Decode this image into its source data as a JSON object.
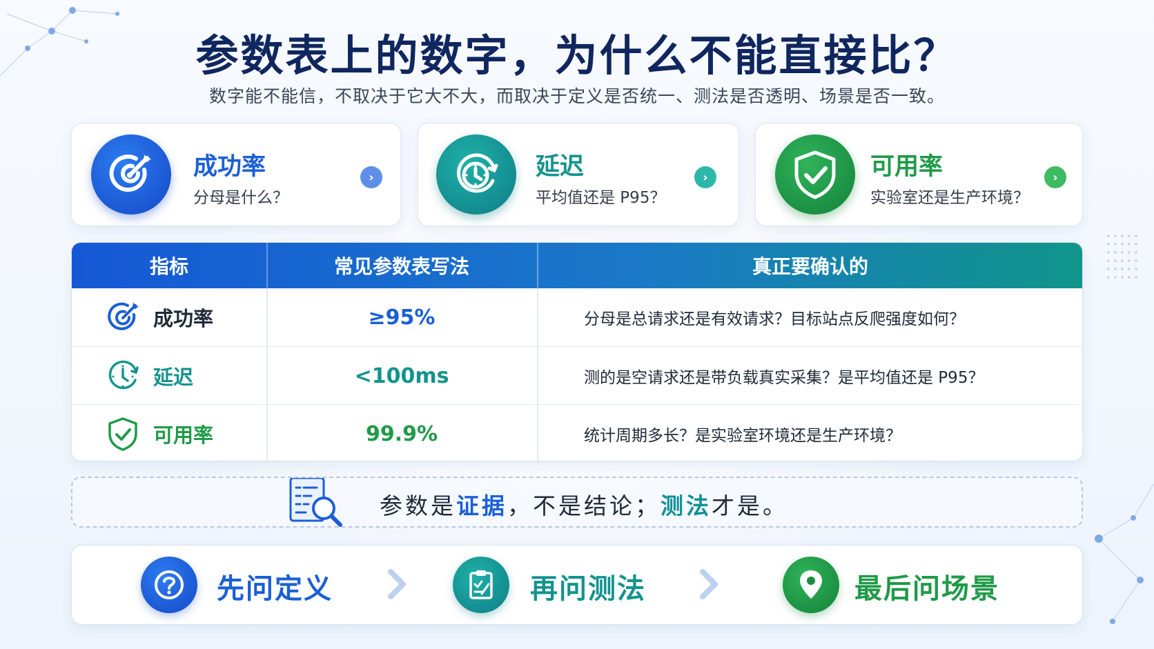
{
  "title": "参数表上的数字，为什么不能直接比？",
  "subtitle": "数字能不能信，不取决于它大不大，而取决于定义是否统一、测法是否透明、场景是否一致。",
  "cards": [
    {
      "title": "成功率",
      "sub": "分母是什么？",
      "icon": "target-icon",
      "color": "#1a5fd6"
    },
    {
      "title": "延迟",
      "sub": "平均值还是 P95？",
      "icon": "clock-icon",
      "color": "#13938f"
    },
    {
      "title": "可用率",
      "sub": "实验室还是生产环境？",
      "icon": "shield-check-icon",
      "color": "#1f9a48"
    }
  ],
  "table": {
    "headers": [
      "指标",
      "常见参数表写法",
      "真正要确认的"
    ],
    "rows": [
      {
        "metric": "成功率",
        "value": "≥95%",
        "confirm": "分母是总请求还是有效请求？目标站点反爬强度如何？",
        "color": "#1a5fd6"
      },
      {
        "metric": "延迟",
        "value": "<100ms",
        "confirm": "测的是空请求还是带负载真实采集？是平均值还是 P95？",
        "color": "#13938f"
      },
      {
        "metric": "可用率",
        "value": "99.9%",
        "confirm": "统计周期多长？是实验室环境还是生产环境？",
        "color": "#1f9a48"
      }
    ]
  },
  "note": {
    "p1": "参数是",
    "b1": "证据",
    "p2": "，不是结论；",
    "b2": "测法",
    "p3": "才是。"
  },
  "steps": [
    {
      "label": "先问定义",
      "icon": "question-icon",
      "color": "#1a5fd6"
    },
    {
      "label": "再问测法",
      "icon": "clipboard-icon",
      "color": "#13938f"
    },
    {
      "label": "最后问场景",
      "icon": "location-pin-icon",
      "color": "#1f9a48"
    }
  ]
}
